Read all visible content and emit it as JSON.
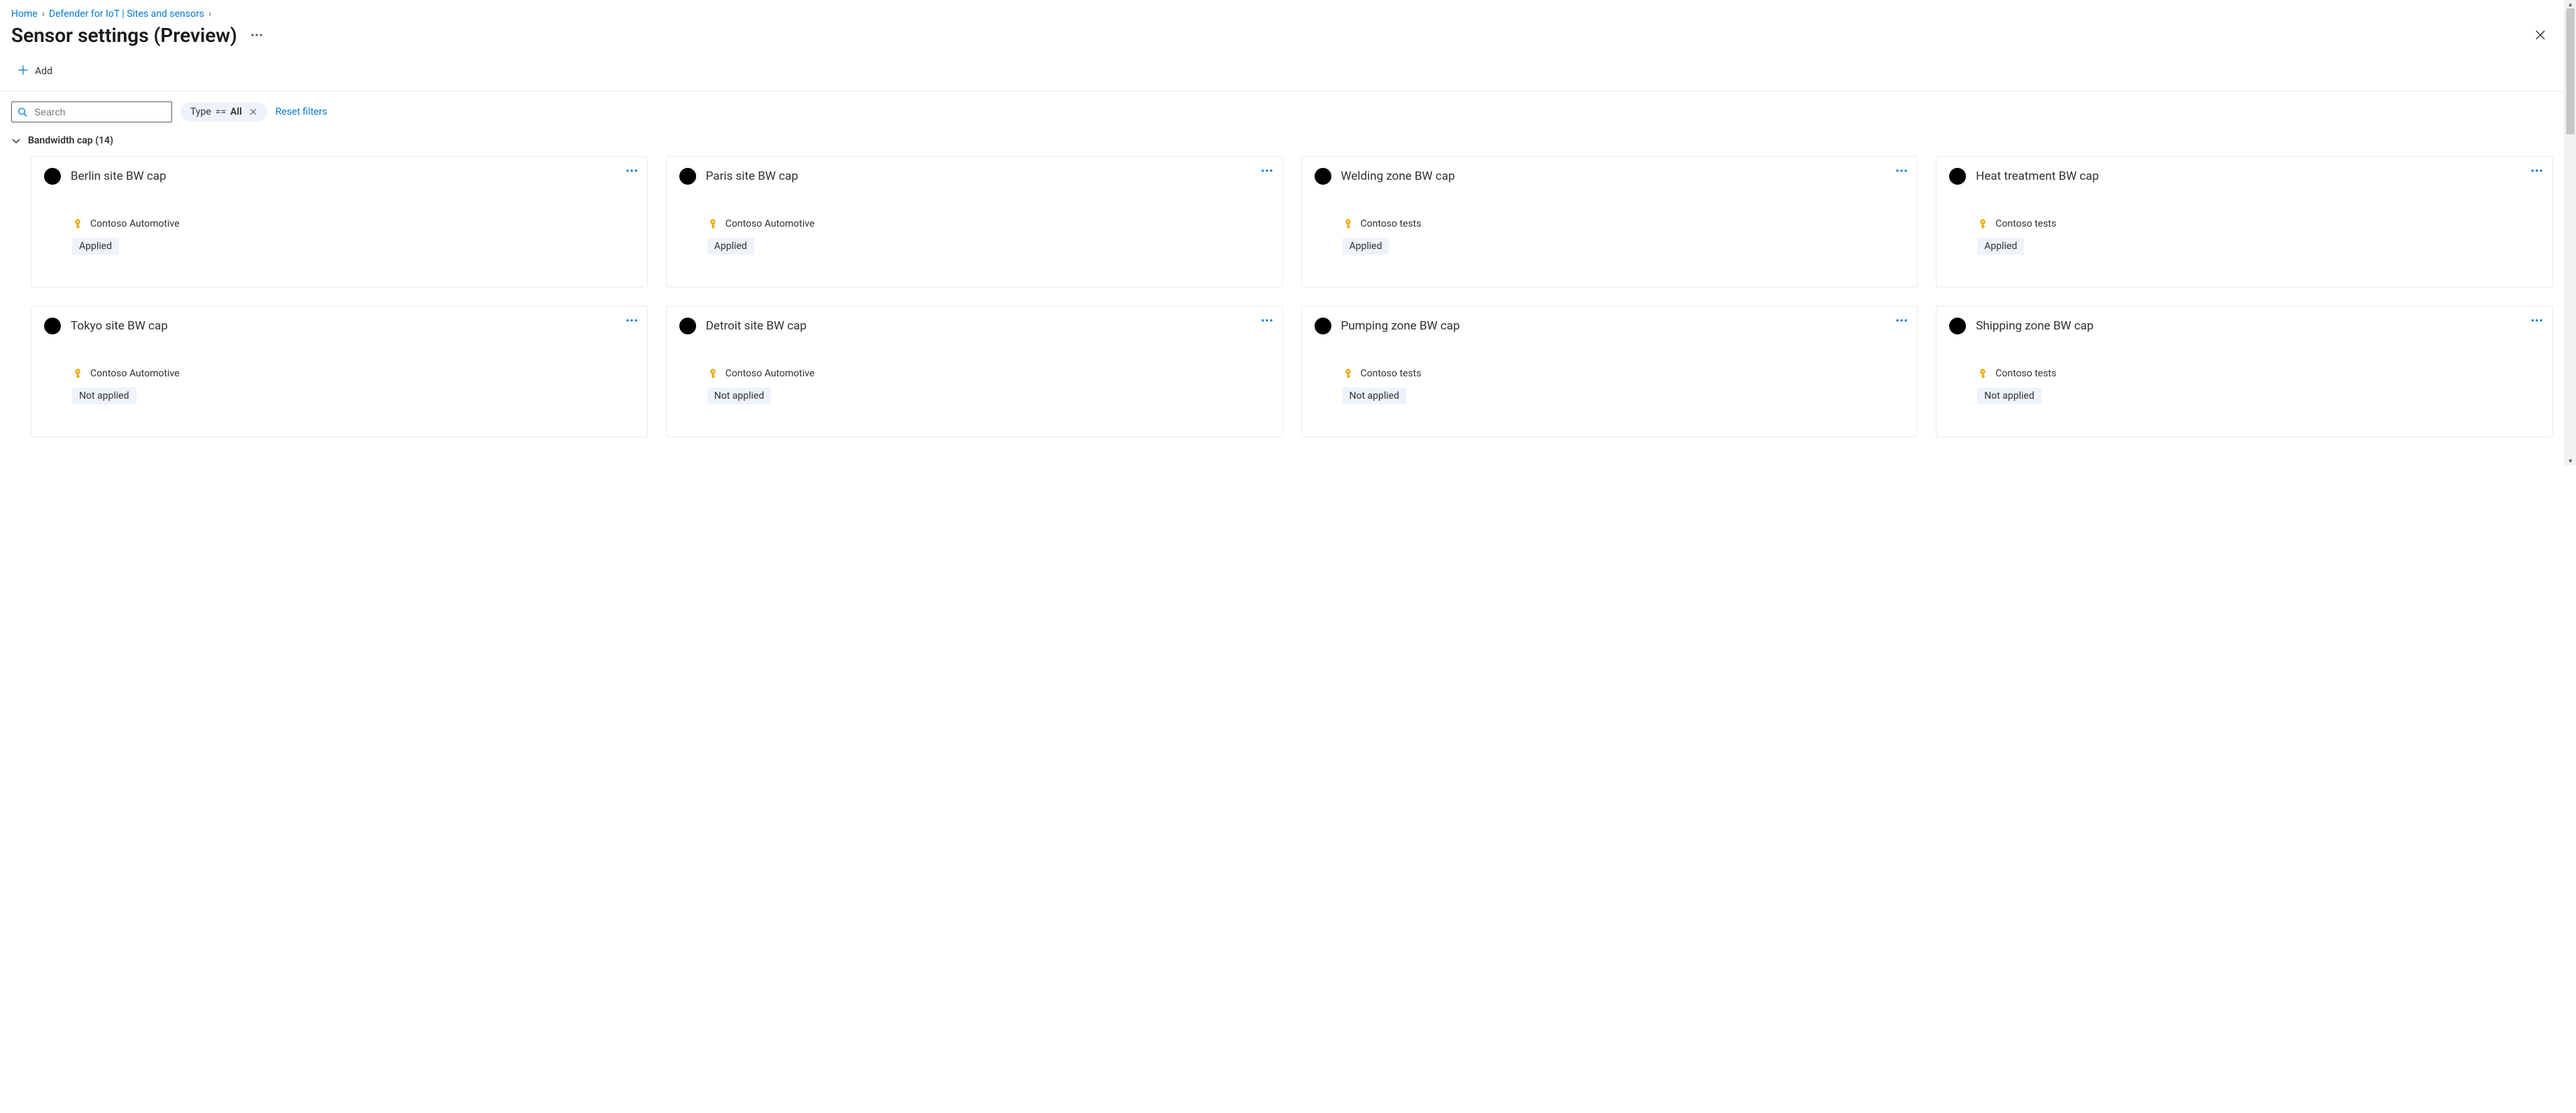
{
  "breadcrumb": {
    "home": "Home",
    "defender": "Defender for IoT | Sites and sensors"
  },
  "page": {
    "title": "Sensor settings (Preview)"
  },
  "toolbar": {
    "add_label": "Add"
  },
  "search": {
    "placeholder": "Search"
  },
  "filter_pill": {
    "key": "Type",
    "op": "==",
    "value": "All"
  },
  "reset_filters_label": "Reset filters",
  "group": {
    "label": "Bandwidth cap (14)"
  },
  "cards": [
    {
      "title": "Berlin site BW cap",
      "workspace": "Contoso Automotive",
      "status": "Applied"
    },
    {
      "title": "Paris site BW cap",
      "workspace": "Contoso Automotive",
      "status": "Applied"
    },
    {
      "title": "Welding zone BW cap",
      "workspace": "Contoso tests",
      "status": "Applied"
    },
    {
      "title": "Heat treatment BW cap",
      "workspace": "Contoso tests",
      "status": "Applied"
    },
    {
      "title": "Tokyo site BW cap",
      "workspace": "Contoso Automotive",
      "status": "Not applied"
    },
    {
      "title": "Detroit site BW cap",
      "workspace": "Contoso Automotive",
      "status": "Not applied"
    },
    {
      "title": "Pumping zone BW cap",
      "workspace": "Contoso tests",
      "status": "Not applied"
    },
    {
      "title": "Shipping zone BW cap",
      "workspace": "Contoso tests",
      "status": "Not applied"
    }
  ]
}
